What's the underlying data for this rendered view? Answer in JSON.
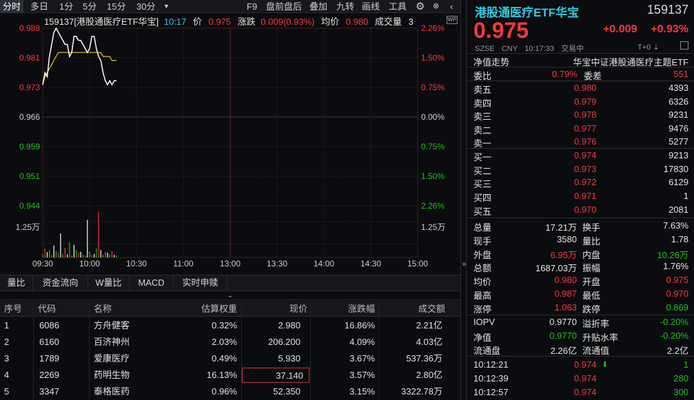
{
  "toolbar": {
    "left": [
      "分时",
      "多日",
      "1分",
      "5分",
      "15分",
      "30分"
    ],
    "right": [
      "F9",
      "盘前盘后",
      "叠加",
      "九转",
      "画线",
      "工具"
    ]
  },
  "chart": {
    "header": {
      "code_name": "159137[港股通医疗ETF华宝]",
      "time": "10:17",
      "price_label": "价",
      "price": "0.975",
      "change_label": "涨跌",
      "change": "0.009(0.93%)",
      "avg_label": "均价",
      "avg": "0.980",
      "vol_label": "成交量",
      "vol": "3"
    },
    "left_ticks": [
      "0.988",
      "0.981",
      "0.973",
      "0.966",
      "0.959",
      "0.951",
      "0.944"
    ],
    "right_ticks": [
      "2.26%",
      "1.50%",
      "0.75%",
      "0.00%",
      "0.75%",
      "1.50%",
      "2.26%"
    ],
    "vol_tick_left": "1.25万",
    "vol_tick_right": "1.25万",
    "time_ticks": [
      "09:30",
      "10:00",
      "10:30",
      "11:00",
      "13:00",
      "13:30",
      "14:00",
      "14:30",
      "15:00"
    ],
    "badge": "WP",
    "chart_data": {
      "type": "line",
      "series": [
        {
          "values": [
            0.974,
            0.977,
            0.976,
            0.981,
            0.984,
            0.987,
            0.988,
            0.987,
            0.986,
            0.985,
            0.984,
            0.984,
            0.981,
            0.982,
            0.986,
            0.986,
            0.985,
            0.985,
            0.984,
            0.983,
            0.982,
            0.983,
            0.986,
            0.986,
            0.983,
            0.981,
            0.98,
            0.977,
            0.975,
            0.974,
            0.975,
            0.974,
            0.975,
            0.975
          ]
        },
        {
          "values": [
            0.974,
            0.976,
            0.977,
            0.978,
            0.979,
            0.98,
            0.981,
            0.982,
            0.982,
            0.982,
            0.982,
            0.982,
            0.982,
            0.982,
            0.982,
            0.982,
            0.982,
            0.982,
            0.982,
            0.982,
            0.982,
            0.982,
            0.982,
            0.982,
            0.982,
            0.982,
            0.982,
            0.981,
            0.981,
            0.981,
            0.981,
            0.98,
            0.98,
            0.98
          ]
        }
      ],
      "ylim": [
        0.944,
        0.988
      ],
      "volume": [
        1200,
        3000,
        1800,
        2500,
        900,
        4000,
        2200,
        1500,
        8000,
        1200,
        3200,
        1000,
        5000,
        700,
        4200,
        2500,
        1700,
        1900,
        1000,
        600,
        12500,
        2000,
        800,
        1200,
        3000,
        15000,
        2500,
        900,
        1800,
        1600,
        1100,
        2100,
        900,
        700
      ]
    }
  },
  "tabs2": [
    "量比",
    "资金流向",
    "W量比",
    "MACD",
    "实时申赎"
  ],
  "table": {
    "headers": [
      "序号",
      "代码",
      "名称",
      "估算权重",
      "现价",
      "涨跌幅",
      "成交额"
    ],
    "rows": [
      [
        "1",
        "6086",
        "方舟健客",
        "0.32%",
        "2.980",
        "16.86%",
        "2.21亿"
      ],
      [
        "2",
        "6160",
        "百济神州",
        "2.03%",
        "206.200",
        "4.09%",
        "4.03亿"
      ],
      [
        "3",
        "1789",
        "爱康医疗",
        "0.49%",
        "5.930",
        "3.67%",
        "537.36万"
      ],
      [
        "4",
        "2269",
        "药明生物",
        "16.13%",
        "37.140",
        "3.57%",
        "2.80亿"
      ],
      [
        "5",
        "3347",
        "泰格医药",
        "0.96%",
        "52.350",
        "3.15%",
        "3322.78万"
      ]
    ]
  },
  "right": {
    "name": "港股通医疗ETF华宝",
    "code": "159137",
    "price": "0.975",
    "change": "+0.009",
    "change_pct": "+0.93%",
    "meta": [
      "SZSE",
      "CNY",
      "10:17:33",
      "交易中"
    ],
    "t0": "T+0",
    "nav_trend": "净值走势",
    "index_name": "华宝中证港股通医疗主题ETF",
    "wb_label": "委比",
    "wb": "0.79%",
    "wc_label": "委差",
    "wc": "551",
    "asks": [
      [
        "卖五",
        "0.980",
        "4393"
      ],
      [
        "卖四",
        "0.979",
        "6326"
      ],
      [
        "卖三",
        "0.978",
        "9231"
      ],
      [
        "卖二",
        "0.977",
        "9476"
      ],
      [
        "卖一",
        "0.976",
        "5277"
      ]
    ],
    "bids": [
      [
        "买一",
        "0.974",
        "9213"
      ],
      [
        "买二",
        "0.973",
        "17830"
      ],
      [
        "买三",
        "0.972",
        "6129"
      ],
      [
        "买四",
        "0.971",
        "1"
      ],
      [
        "买五",
        "0.970",
        "2081"
      ]
    ],
    "stats": [
      [
        "总量",
        "17.21万",
        "换手",
        "7.63%"
      ],
      [
        "现手",
        "3580",
        "量比",
        "1.78"
      ],
      [
        "外盘",
        "6.95万",
        "内盘",
        "10.26万"
      ],
      [
        "总额",
        "1687.03万",
        "振幅",
        "1.76%"
      ],
      [
        "均价",
        "0.980",
        "开盘",
        "0.975"
      ],
      [
        "最高",
        "0.987",
        "最低",
        "0.970"
      ],
      [
        "涨停",
        "1.063",
        "跌停",
        "0.869"
      ]
    ],
    "iopv": [
      [
        "IOPV",
        "0.9770",
        "溢折率",
        "-0.20%"
      ],
      [
        "净值",
        "0.9770",
        "升贴水率",
        "-0.20%"
      ],
      [
        "流通盘",
        "2.26亿",
        "流通值",
        "2.2亿"
      ]
    ],
    "trades": [
      [
        "10:12:21",
        "0.974",
        "1"
      ],
      [
        "10:12:39",
        "0.974",
        "280"
      ],
      [
        "10:12:57",
        "0.974",
        "300"
      ]
    ]
  },
  "colors": {
    "up": "#f5393d",
    "down": "#16c616",
    "price_line": "#ffffff",
    "avg_line": "#e8c34a",
    "accent": "#33c9e0"
  }
}
